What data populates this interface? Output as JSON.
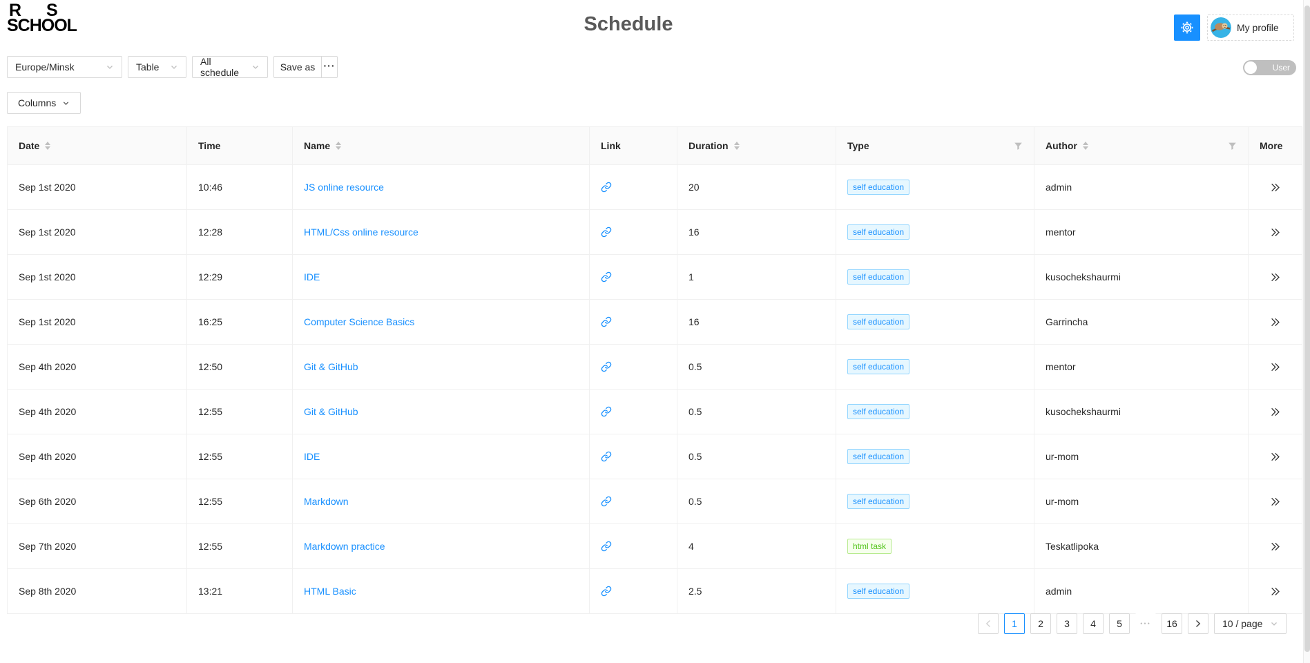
{
  "header": {
    "logo": {
      "line1_left": "R",
      "line1_right": "S",
      "line2": "SCHOOL"
    },
    "title": "Schedule",
    "profile_label": "My profile"
  },
  "toolbar": {
    "timezone_select": "Europe/Minsk",
    "view_select": "Table",
    "schedule_select": "All schedule",
    "save_as_label": "Save as",
    "more_menu": "···",
    "user_toggle_label": "User",
    "columns_button": "Columns"
  },
  "table": {
    "columns": [
      {
        "key": "date",
        "label": "Date",
        "sorter": true,
        "filter": false
      },
      {
        "key": "time",
        "label": "Time",
        "sorter": false,
        "filter": false
      },
      {
        "key": "name",
        "label": "Name",
        "sorter": true,
        "filter": false
      },
      {
        "key": "link",
        "label": "Link",
        "sorter": false,
        "filter": false
      },
      {
        "key": "duration",
        "label": "Duration",
        "sorter": true,
        "filter": false
      },
      {
        "key": "type",
        "label": "Type",
        "sorter": false,
        "filter": true
      },
      {
        "key": "author",
        "label": "Author",
        "sorter": true,
        "filter": true
      },
      {
        "key": "more",
        "label": "More",
        "sorter": false,
        "filter": false
      }
    ],
    "rows": [
      {
        "date": "Sep 1st 2020",
        "time": "10:46",
        "name": "JS online resource",
        "duration": "20",
        "type": "self education",
        "type_color": "blue",
        "author": "admin"
      },
      {
        "date": "Sep 1st 2020",
        "time": "12:28",
        "name": "HTML/Css online resource",
        "duration": "16",
        "type": "self education",
        "type_color": "blue",
        "author": "mentor"
      },
      {
        "date": "Sep 1st 2020",
        "time": "12:29",
        "name": "IDE",
        "duration": "1",
        "type": "self education",
        "type_color": "blue",
        "author": "kusochekshaurmi"
      },
      {
        "date": "Sep 1st 2020",
        "time": "16:25",
        "name": "Computer Science Basics",
        "duration": "16",
        "type": "self education",
        "type_color": "blue",
        "author": "Garrincha"
      },
      {
        "date": "Sep 4th 2020",
        "time": "12:50",
        "name": "Git & GitHub",
        "duration": "0.5",
        "type": "self education",
        "type_color": "blue",
        "author": "mentor"
      },
      {
        "date": "Sep 4th 2020",
        "time": "12:55",
        "name": "Git & GitHub",
        "duration": "0.5",
        "type": "self education",
        "type_color": "blue",
        "author": "kusochekshaurmi"
      },
      {
        "date": "Sep 4th 2020",
        "time": "12:55",
        "name": "IDE",
        "duration": "0.5",
        "type": "self education",
        "type_color": "blue",
        "author": "ur-mom"
      },
      {
        "date": "Sep 6th 2020",
        "time": "12:55",
        "name": "Markdown",
        "duration": "0.5",
        "type": "self education",
        "type_color": "blue",
        "author": "ur-mom"
      },
      {
        "date": "Sep 7th 2020",
        "time": "12:55",
        "name": "Markdown practice",
        "duration": "4",
        "type": "html task",
        "type_color": "green",
        "author": "Teskatlipoka"
      },
      {
        "date": "Sep 8th 2020",
        "time": "13:21",
        "name": "HTML Basic",
        "duration": "2.5",
        "type": "self education",
        "type_color": "blue",
        "author": "admin"
      }
    ]
  },
  "pagination": {
    "pages": [
      "1",
      "2",
      "3",
      "4",
      "5"
    ],
    "active_page": "1",
    "ellipsis": "•••",
    "last_page": "16",
    "page_size": "10 / page"
  },
  "colors": {
    "accent": "#1890ff",
    "link": "#1890ff",
    "tag_blue_text": "#1890ff",
    "tag_blue_bg": "#e6f7ff",
    "tag_blue_border": "#91d5ff",
    "tag_green_text": "#52c41a",
    "tag_green_bg": "#f6ffed",
    "tag_green_border": "#b7eb8f",
    "table_header_bg": "#fafafa",
    "table_border": "#f0f0f0",
    "toggle_off_bg": "rgba(0,0,0,0.25)"
  }
}
